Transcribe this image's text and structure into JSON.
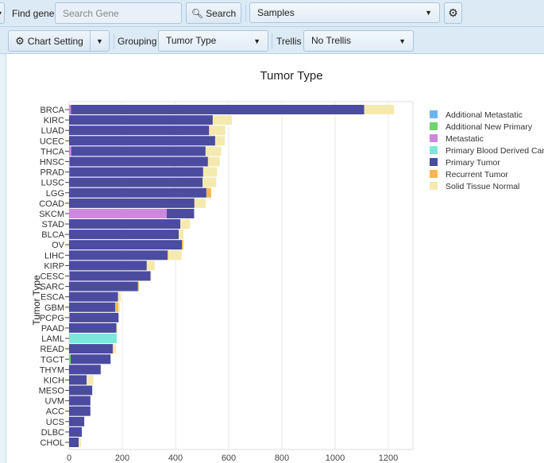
{
  "toolbar": {
    "find_gene_label": "Find gene",
    "search_placeholder": "Search Gene",
    "search_button": "Search",
    "samples_select": "Samples",
    "chart_setting_button": "Chart Setting",
    "grouping_label": "Grouping",
    "grouping_value": "Tumor Type",
    "trellis_label": "Trellis",
    "trellis_value": "No Trellis"
  },
  "colors": {
    "accent_bg": "#dceaf5"
  },
  "chart_data": {
    "type": "bar",
    "orientation": "horizontal",
    "stacked": true,
    "title": "Tumor Type",
    "xlabel": "",
    "ylabel": "Tumor Type",
    "xlim": [
      0,
      1290
    ],
    "xticks": [
      0,
      200,
      400,
      600,
      800,
      1000,
      1200
    ],
    "grid": true,
    "legend_position": "right",
    "categories": [
      "BRCA",
      "KIRC",
      "LUAD",
      "UCEC",
      "THCA",
      "HNSC",
      "PRAD",
      "LUSC",
      "LGG",
      "COAD",
      "SKCM",
      "STAD",
      "BLCA",
      "OV",
      "LIHC",
      "KIRP",
      "CESC",
      "SARC",
      "ESCA",
      "GBM",
      "PCPG",
      "PAAD",
      "LAML",
      "READ",
      "TGCT",
      "THYM",
      "KICH",
      "MESO",
      "UVM",
      "ACC",
      "UCS",
      "DLBC",
      "CHOL"
    ],
    "series": [
      {
        "name": "Additional Metastatic",
        "color": "#6db3ef",
        "values": [
          0,
          0,
          0,
          0,
          0,
          0,
          0,
          0,
          0,
          0,
          0,
          0,
          0,
          0,
          0,
          0,
          0,
          0,
          0,
          0,
          0,
          0,
          0,
          0,
          0,
          0,
          0,
          0,
          0,
          0,
          0,
          0,
          0
        ]
      },
      {
        "name": "Additional New Primary",
        "color": "#6fd46f",
        "values": [
          0,
          0,
          0,
          0,
          0,
          0,
          0,
          0,
          0,
          0,
          0,
          0,
          0,
          0,
          0,
          0,
          0,
          0,
          0,
          0,
          0,
          0,
          0,
          0,
          6,
          0,
          0,
          0,
          0,
          0,
          0,
          0,
          0
        ]
      },
      {
        "name": "Metastatic",
        "color": "#cc88dd",
        "values": [
          7,
          0,
          0,
          0,
          8,
          2,
          1,
          0,
          0,
          0,
          367,
          0,
          0,
          0,
          0,
          0,
          2,
          0,
          0,
          0,
          2,
          0,
          0,
          0,
          0,
          0,
          0,
          0,
          0,
          0,
          0,
          0,
          0
        ]
      },
      {
        "name": "Primary Blood Derived Cancer",
        "color": "#7ae8dc",
        "values": [
          0,
          0,
          0,
          0,
          0,
          0,
          0,
          0,
          0,
          0,
          0,
          0,
          0,
          0,
          0,
          0,
          0,
          0,
          0,
          0,
          0,
          0,
          179,
          0,
          0,
          0,
          0,
          0,
          0,
          0,
          0,
          0,
          0
        ]
      },
      {
        "name": "Primary Tumor",
        "color": "#4b4ba0",
        "values": [
          1102,
          540,
          526,
          549,
          505,
          520,
          503,
          502,
          516,
          471,
          103,
          418,
          412,
          424,
          370,
          292,
          304,
          259,
          184,
          173,
          184,
          178,
          0,
          164,
          150,
          119,
          66,
          87,
          80,
          80,
          57,
          48,
          36
        ]
      },
      {
        "name": "Recurrent Tumor",
        "color": "#fbb84a",
        "values": [
          0,
          0,
          2,
          1,
          0,
          0,
          0,
          0,
          18,
          1,
          0,
          0,
          0,
          5,
          3,
          0,
          0,
          3,
          0,
          12,
          0,
          0,
          0,
          2,
          0,
          0,
          0,
          0,
          0,
          0,
          0,
          0,
          0
        ]
      },
      {
        "name": "Solid Tissue Normal",
        "color": "#f4eab0",
        "values": [
          113,
          72,
          59,
          35,
          59,
          44,
          52,
          51,
          0,
          41,
          1,
          36,
          18,
          0,
          50,
          30,
          3,
          2,
          11,
          6,
          3,
          4,
          0,
          10,
          0,
          2,
          25,
          0,
          0,
          0,
          0,
          0,
          9
        ]
      }
    ]
  }
}
